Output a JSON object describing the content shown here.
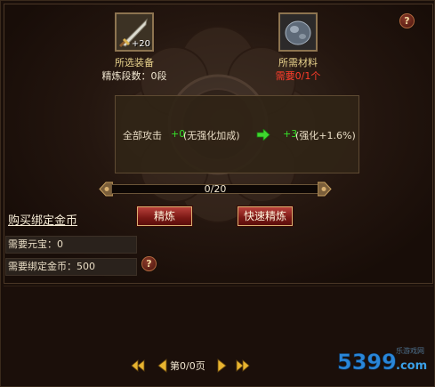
{
  "equip": {
    "icon": "sword-icon",
    "bonus": "+20",
    "label": "所选装备",
    "refine_label": "精炼段数：0段"
  },
  "material": {
    "icon": "ore-icon",
    "label": "所需材料",
    "need": "需要0/1个"
  },
  "effect": {
    "stat": "全部攻击",
    "current_value": "+0",
    "current_note": "(无强化加成)",
    "arrow_icon": "right-arrow-icon",
    "next_value": "+3",
    "next_note": "(强化+1.6%)"
  },
  "progress": {
    "text": "0/20",
    "fraction": 0
  },
  "buttons": {
    "refine": "精炼",
    "quick_refine": "快速精炼"
  },
  "buy": {
    "title": "购买绑定金币",
    "need_yuanbao": "需要元宝：0",
    "need_gold": "需要绑定金币：500"
  },
  "pager": {
    "text": "第0/0页"
  },
  "watermark": {
    "logo": "5399.com",
    "tagline": "乐游戏网"
  },
  "colors": {
    "green": "#35e02a",
    "red": "#ff3c2a",
    "gold": "#e8d28c"
  }
}
